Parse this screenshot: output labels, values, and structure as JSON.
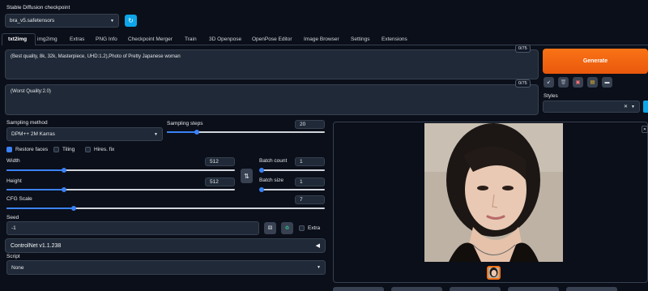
{
  "checkpoint": {
    "label": "Stable Diffusion checkpoint",
    "value": "bra_v5.safetensors"
  },
  "tabs": [
    "txt2img",
    "img2img",
    "Extras",
    "PNG Info",
    "Checkpoint Merger",
    "Train",
    "3D Openpose",
    "OpenPose Editor",
    "Image Browser",
    "Settings",
    "Extensions"
  ],
  "prompt": {
    "text": "(Best quality, 8k, 32k, Masterpiece, UHD:1.2),Photo of Pretty Japanese woman",
    "counter": "0/75"
  },
  "negative_prompt": {
    "text": "(Worst Quality:2.0)",
    "counter": "0/75"
  },
  "generate_label": "Generate",
  "styles_label": "Styles",
  "sampling_method": {
    "label": "Sampling method",
    "value": "DPM++ 2M Karras"
  },
  "sampling_steps": {
    "label": "Sampling steps",
    "value": "20",
    "fraction": 0.19
  },
  "checks": {
    "restore_faces": "Restore faces",
    "tiling": "Tiling",
    "hires_fix": "Hires. fix"
  },
  "width": {
    "label": "Width",
    "value": "512",
    "fraction": 0.25
  },
  "height": {
    "label": "Height",
    "value": "512",
    "fraction": 0.25
  },
  "batch_count": {
    "label": "Batch count",
    "value": "1",
    "fraction": 0.0
  },
  "batch_size": {
    "label": "Batch size",
    "value": "1",
    "fraction": 0.0
  },
  "cfg_scale": {
    "label": "CFG Scale",
    "value": "7",
    "fraction": 0.21
  },
  "seed": {
    "label": "Seed",
    "value": "-1",
    "extra_label": "Extra"
  },
  "controlnet": {
    "label": "ControlNet v1.1.238"
  },
  "script": {
    "label": "Script",
    "value": "None"
  },
  "colors": {
    "accent": "#3b82f6",
    "generate": "#ea580c",
    "background": "#0b0f19"
  }
}
